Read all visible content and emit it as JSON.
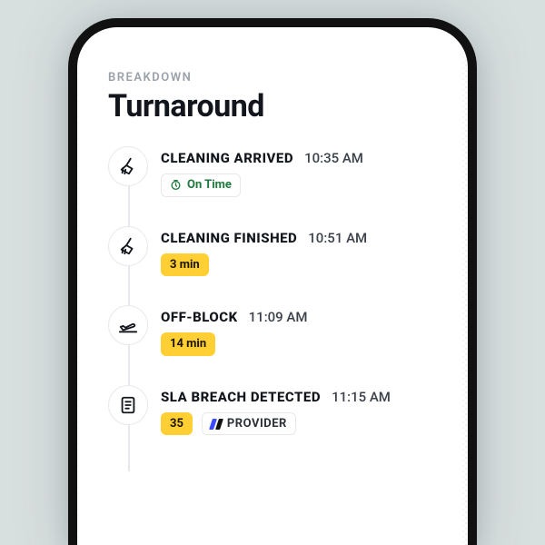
{
  "header": {
    "eyebrow": "BREAKDOWN",
    "title": "Turnaround"
  },
  "events": [
    {
      "icon": "broom-icon",
      "label": "CLEANING ARRIVED",
      "time": "10:35 AM",
      "badge": {
        "kind": "ontime",
        "text": "On Time"
      }
    },
    {
      "icon": "broom-icon",
      "label": "CLEANING FINISHED",
      "time": "10:51 AM",
      "badge": {
        "kind": "delay",
        "text": "3 min"
      }
    },
    {
      "icon": "takeoff-icon",
      "label": "OFF-BLOCK",
      "time": "11:09 AM",
      "badge": {
        "kind": "delay",
        "text": "14 min"
      }
    },
    {
      "icon": "document-icon",
      "label": "SLA BREACH DETECTED",
      "time": "11:15 AM",
      "badge": {
        "kind": "delay",
        "text": "35"
      },
      "extra_badge": {
        "kind": "provider",
        "text": "PROVIDER"
      }
    }
  ]
}
